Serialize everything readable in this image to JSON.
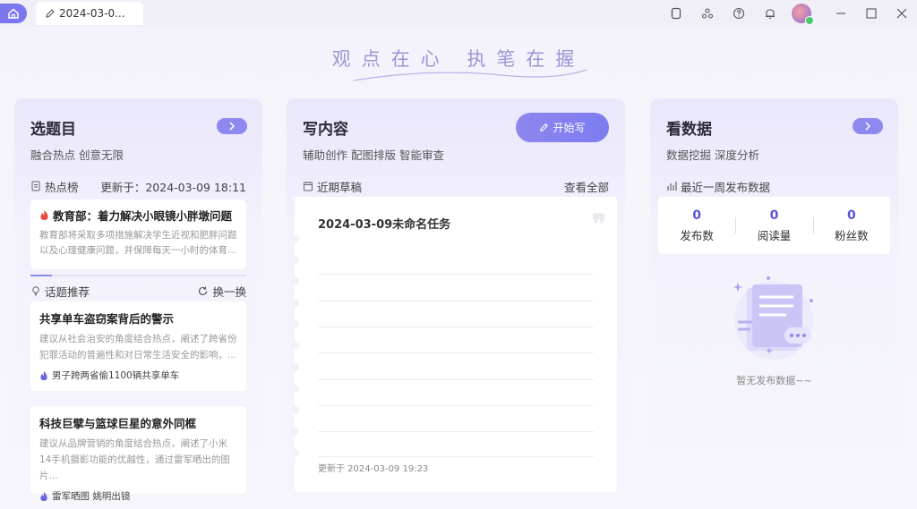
{
  "titlebar": {
    "tab_label": "2024-03-0...",
    "icons": [
      "home-icon",
      "edit-icon",
      "notebook-icon",
      "share-icon",
      "help-icon",
      "bell-icon",
      "avatar",
      "minimize-icon",
      "maximize-icon",
      "close-icon"
    ]
  },
  "slogan": "观点在心 执笔在握",
  "colors": {
    "accent": "#8e89ee",
    "hot_red": "#e8483c",
    "stat_blue": "#5a55d6"
  },
  "topics_card": {
    "title": "选题目",
    "subtitle": "融合热点 创意无限",
    "hot_list_label": "热点榜",
    "updated_at": "更新于：2024-03-09 18:11",
    "hot_item": {
      "title": "教育部：着力解决小眼镜小胖墩问题",
      "desc": "教育部将采取多项措施解决学生近视和肥胖问题以及心理健康问题，并保障每天一小时的体育..."
    },
    "carousel_progress": 0.1,
    "recommend_label": "话题推荐",
    "refresh_label": "换一换",
    "recommendations": [
      {
        "title": "共享单车盗窃案背后的警示",
        "desc": "建议从社会治安的角度结合热点，阐述了跨省份犯罪活动的普遍性和对日常生活安全的影响，...",
        "tag": "男子跨两省偷1100辆共享单车"
      },
      {
        "title": "科技巨擘与篮球巨星的意外同框",
        "desc": "建议从品牌营销的角度结合热点，阐述了小米14手机摄影功能的优越性，通过雷军晒出的图片...",
        "tag": "雷军晒图 姚明出镜"
      }
    ]
  },
  "write_card": {
    "title": "写内容",
    "subtitle": "辅助创作 配图排版 智能审查",
    "start_button": "开始写",
    "drafts_label": "近期草稿",
    "view_all": "查看全部",
    "draft": {
      "title": "2024-03-09未命名任务",
      "updated": "更新于 2024-03-09 19:23"
    }
  },
  "data_card": {
    "title": "看数据",
    "subtitle": "数据挖掘 深度分析",
    "week_label": "最近一周发布数据",
    "stats": [
      {
        "value": "0",
        "label": "发布数"
      },
      {
        "value": "0",
        "label": "阅读量"
      },
      {
        "value": "0",
        "label": "粉丝数"
      }
    ],
    "empty_text": "暂无发布数据~~"
  }
}
